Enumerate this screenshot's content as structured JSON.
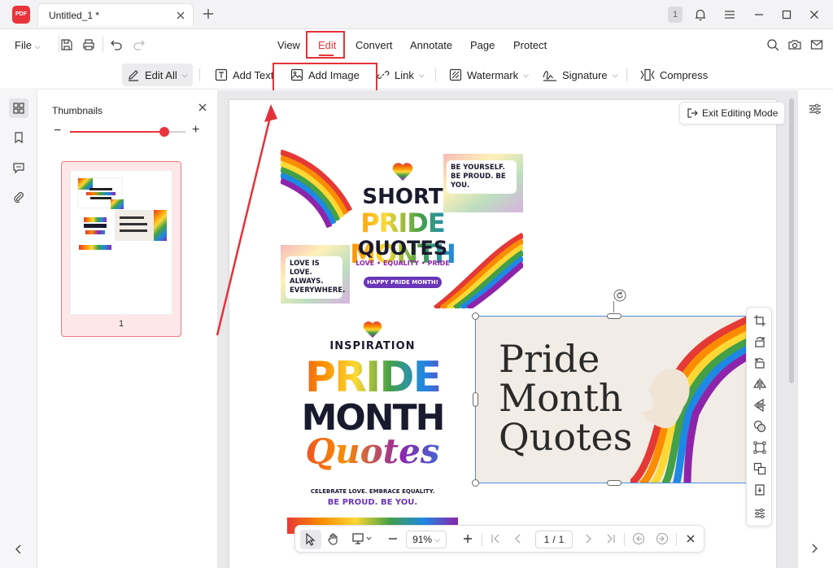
{
  "app": {
    "logo_text": "PDF",
    "tab_title": "Untitled_1 *",
    "page_badge": "1"
  },
  "menu": {
    "file": "File",
    "items": [
      "View",
      "Edit",
      "Convert",
      "Annotate",
      "Page",
      "Protect"
    ],
    "active": "Edit"
  },
  "toolbar": {
    "edit_all": "Edit All",
    "add_text": "Add Text",
    "add_image": "Add Image",
    "link": "Link",
    "watermark": "Watermark",
    "signature": "Signature",
    "compress": "Compress"
  },
  "thumbnails": {
    "title": "Thumbnails",
    "zoom_level": 0.5,
    "page_label": "1"
  },
  "canvas": {
    "exit_editing": "Exit Editing Mode"
  },
  "image1": {
    "line1": "SHORT",
    "line2": "PRIDE MONTH",
    "line3": "QUOTES",
    "tagline": "LOVE • EQUALITY • PRIDE",
    "pill": "HAPPY PRIDE MONTH!",
    "bubble_a": "BE YOURSELF. BE PROUD. BE YOU.",
    "bubble_b": "LOVE IS LOVE. ALWAYS. EVERYWHERE."
  },
  "image2": {
    "eyebrow": "INSPIRATION",
    "line1": "PRIDE",
    "line2": "MONTH",
    "line3": "Quotes",
    "sub1": "CELEBRATE LOVE. EMBRACE EQUALITY.",
    "sub2": "BE PROUD. BE YOU."
  },
  "image3": {
    "line1": "Pride",
    "line2": "Month",
    "line3": "Quotes"
  },
  "bottombar": {
    "zoom": "91%",
    "current_page": "1",
    "separator": "/",
    "total_pages": "1"
  },
  "colors": {
    "accent": "#e8343a",
    "selection": "#4a8de0",
    "rainbow": [
      "#e53935",
      "#fb8c00",
      "#fdd835",
      "#43a047",
      "#1e88e5",
      "#8e24aa"
    ]
  }
}
